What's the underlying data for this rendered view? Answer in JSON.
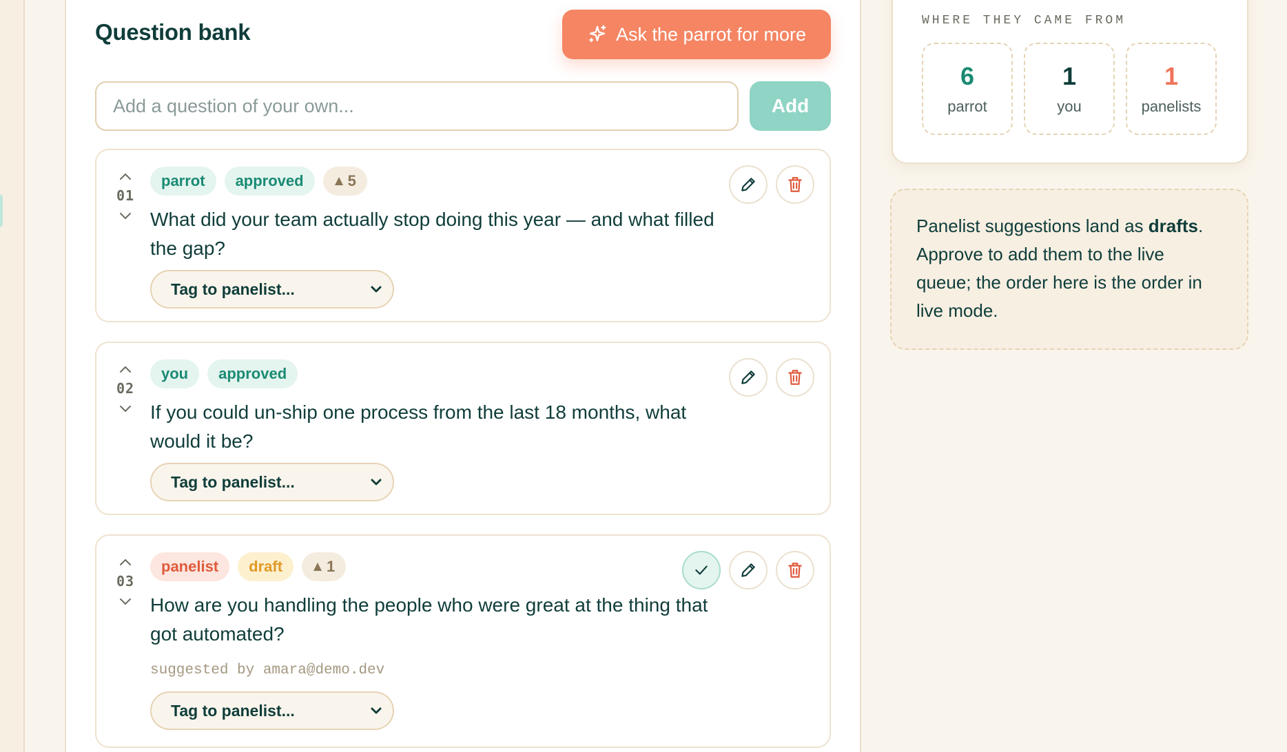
{
  "header": {
    "title": "Question bank",
    "ask_button": "Ask the parrot for more"
  },
  "composer": {
    "placeholder": "Add a question of your own...",
    "add_label": "Add"
  },
  "questions": [
    {
      "number": "01",
      "tags": [
        "parrot",
        "approved"
      ],
      "votes": "5",
      "text": "What did your team actually stop doing this year — and what filled the gap?",
      "tag_select": "Tag to panelist...",
      "suggested_by": ""
    },
    {
      "number": "02",
      "tags": [
        "you",
        "approved"
      ],
      "votes": "",
      "text": "If you could un-ship one process from the last 18 months, what would it be?",
      "tag_select": "Tag to panelist...",
      "suggested_by": ""
    },
    {
      "number": "03",
      "tags": [
        "panelist",
        "draft"
      ],
      "votes": "1",
      "text": "How are you handling the people who were great at the thing that got automated?",
      "tag_select": "Tag to panelist...",
      "suggested_by": "suggested by amara@demo.dev"
    }
  ],
  "origins": {
    "title": "WHERE THEY CAME FROM",
    "items": [
      {
        "count": "6",
        "label": "parrot",
        "color": "#1a8a73"
      },
      {
        "count": "1",
        "label": "you",
        "color": "#0f3d3a"
      },
      {
        "count": "1",
        "label": "panelists",
        "color": "#f0745a"
      }
    ]
  },
  "note": {
    "text_before": "Panelist suggestions land as ",
    "emphasis": "drafts",
    "text_after": ". Approve to add them to the live queue; the order here is the order in live mode."
  },
  "colors": {
    "accent": "#f58563",
    "teal": "#1a8a73",
    "add_button": "#8fd4c5",
    "background": "#faf5ec"
  },
  "icons": [
    "sparkle-icon",
    "chevron-up-icon",
    "chevron-down-icon",
    "triangle-up-icon",
    "pencil-icon",
    "trash-icon",
    "check-icon"
  ]
}
